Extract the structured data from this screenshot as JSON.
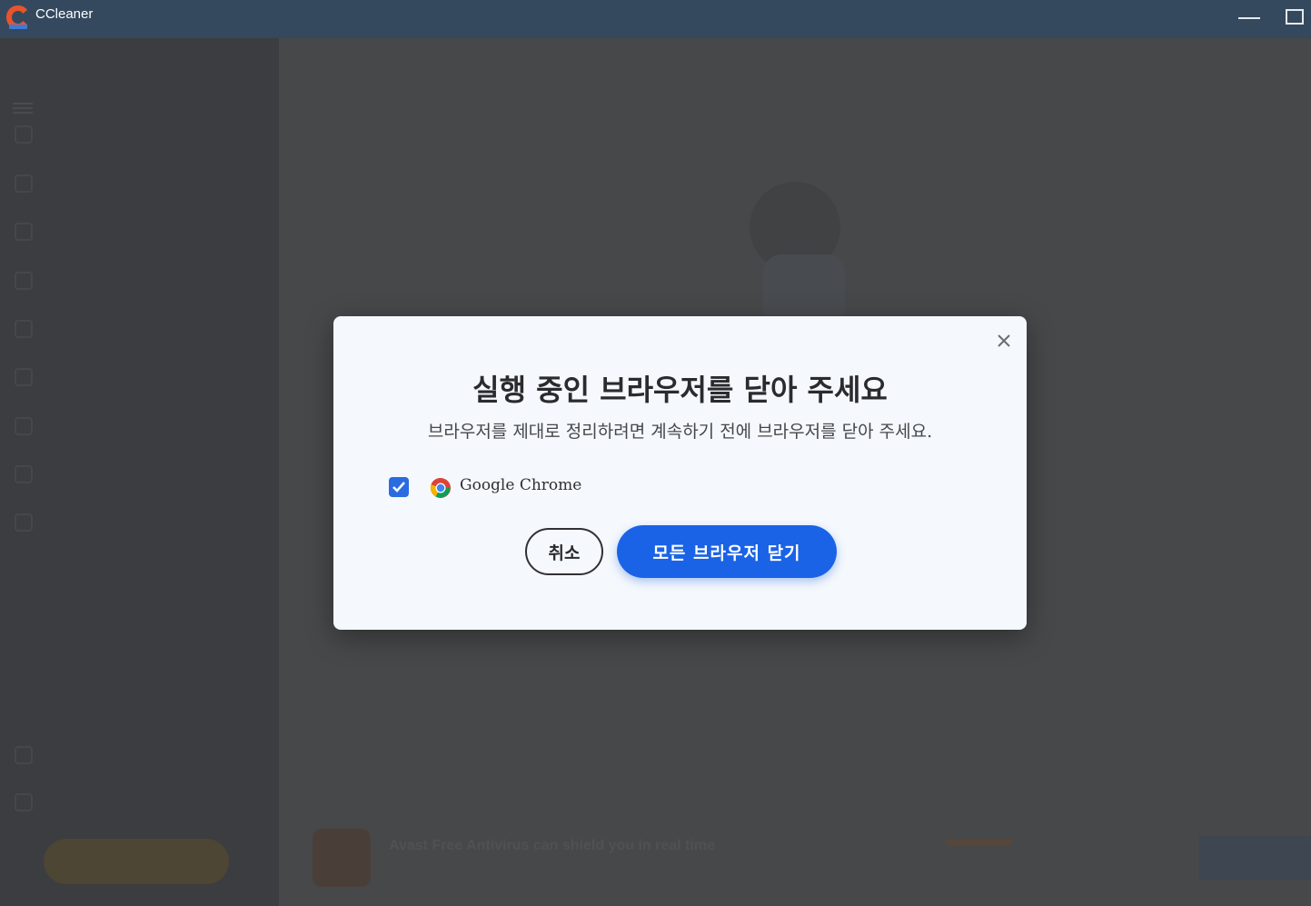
{
  "window": {
    "title": "CCleaner",
    "titlebar_color": "#34495e"
  },
  "dialog": {
    "title": "실행 중인 브라우저를 닫아 주세요",
    "subtitle": "브라우저를 제대로 정리하려면 계속하기 전에 브라우저를 닫아 주세요.",
    "browsers": [
      {
        "name": "Google Chrome",
        "checked": true,
        "icon": "chrome-icon"
      }
    ],
    "cancel_label": "취소",
    "primary_label": "모든 브라우저 닫기",
    "accent_color": "#1a63e6"
  },
  "background": {
    "ad": {
      "headline": "Avast Free Antivirus can shield you in real time"
    }
  }
}
